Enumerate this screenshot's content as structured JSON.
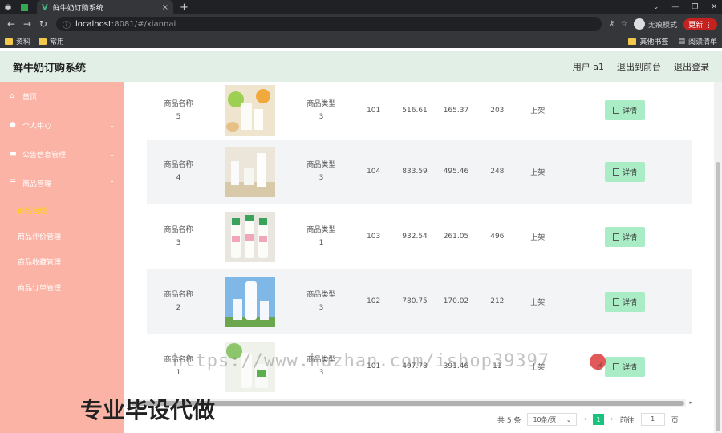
{
  "browser": {
    "tab_title": "鲜牛奶订购系统",
    "url_host": "localhost",
    "url_port_path": ":8081/#/xiannai",
    "incognito_label": "无痕模式",
    "update_label": "更新",
    "bookmarks": [
      "资料",
      "常用"
    ],
    "bookmarks_right": [
      "其他书签",
      "阅读清单"
    ]
  },
  "header": {
    "title": "鲜牛奶订购系统",
    "user": "用户 a1",
    "back_front": "退出到前台",
    "logout": "退出登录"
  },
  "sidebar": {
    "items": [
      {
        "label": "首页",
        "icon": "home-icon"
      },
      {
        "label": "个人中心",
        "icon": "user-icon"
      },
      {
        "label": "公告信息管理",
        "icon": "briefcase-icon"
      },
      {
        "label": "商品管理",
        "icon": "menu-icon"
      }
    ],
    "sub_items": [
      "商品管理",
      "商品评价管理",
      "商品收藏管理",
      "商品订单管理"
    ]
  },
  "table": {
    "rows": [
      {
        "name": "商品名称",
        "no": "5",
        "type": "商品类型",
        "type_no": "3",
        "id": "101",
        "price1": "516.61",
        "price2": "165.37",
        "stock": "203",
        "status": "上架",
        "op": "详情"
      },
      {
        "name": "商品名称",
        "no": "4",
        "type": "商品类型",
        "type_no": "3",
        "id": "104",
        "price1": "833.59",
        "price2": "495.46",
        "stock": "248",
        "status": "上架",
        "op": "详情"
      },
      {
        "name": "商品名称",
        "no": "3",
        "type": "商品类型",
        "type_no": "1",
        "id": "103",
        "price1": "932.54",
        "price2": "261.05",
        "stock": "496",
        "status": "上架",
        "op": "详情"
      },
      {
        "name": "商品名称",
        "no": "2",
        "type": "商品类型",
        "type_no": "3",
        "id": "102",
        "price1": "780.75",
        "price2": "170.02",
        "stock": "212",
        "status": "上架",
        "op": "详情"
      },
      {
        "name": "商品名称",
        "no": "1",
        "type": "商品类型",
        "type_no": "3",
        "id": "101",
        "price1": "497.78",
        "price2": "391.46",
        "stock": "11",
        "status": "上架",
        "op": "详情"
      }
    ]
  },
  "pager": {
    "total": "共 5 条",
    "page_size": "10条/页",
    "current": "1",
    "goto_label": "前往",
    "goto_value": "1",
    "page_suffix": "页"
  },
  "overlay": {
    "watermark": "https://www.huzhan.com/ishop39397",
    "promo": "专业毕设代做"
  },
  "colors": {
    "sidebar_bg": "#fbb3a5",
    "header_bg": "#e2efe7",
    "detail_btn": "#a9ecc6",
    "pager_active": "#19c37d"
  }
}
